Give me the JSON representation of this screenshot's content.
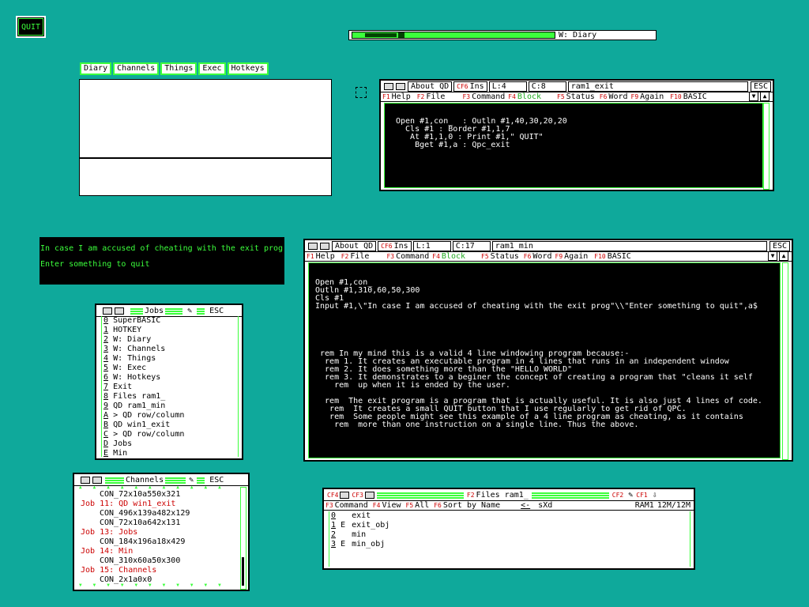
{
  "quit_button": {
    "label": "QUIT"
  },
  "top_bar": {
    "title": "W: Diary"
  },
  "hotkey_menu": {
    "items": [
      "Diary",
      "Channels",
      "Things",
      "Exec",
      "Hotkeys"
    ]
  },
  "console": {
    "lines": [
      "In case I am accused of cheating with the exit prog",
      "Enter something to quit"
    ]
  },
  "editor1": {
    "toolbar": {
      "about": "About QD",
      "cf6": "CF6",
      "ins": "Ins",
      "line": "L:4",
      "col": "C:8",
      "filename": "ram1_exit",
      "esc": "ESC"
    },
    "menu": [
      {
        "key": "F1",
        "label": "Help"
      },
      {
        "key": "F2",
        "label": "File"
      },
      {
        "key": "F3",
        "label": "Command"
      },
      {
        "key": "F4",
        "label": "Block"
      },
      {
        "key": "F5",
        "label": "Status"
      },
      {
        "key": "F6",
        "label": "Word"
      },
      {
        "key": "F9",
        "label": "Again"
      },
      {
        "key": "F10",
        "label": "BASIC"
      }
    ],
    "text": "Open #1,con_  : Outln #1,40,30,20,20\n  Cls #1 : Border #1,1,7\n   At #1,1,0 : Print #1,\" QUIT\"\n    Bget #1,a : Qpc_exit"
  },
  "editor2": {
    "toolbar": {
      "about": "About QD",
      "cf6": "CF6",
      "ins": "Ins",
      "line": "L:1",
      "col": "C:17",
      "filename": "ram1_min",
      "esc": "ESC"
    },
    "menu": [
      {
        "key": "F1",
        "label": "Help"
      },
      {
        "key": "F2",
        "label": "File"
      },
      {
        "key": "F3",
        "label": "Command"
      },
      {
        "key": "F4",
        "label": "Block"
      },
      {
        "key": "F5",
        "label": "Status"
      },
      {
        "key": "F6",
        "label": "Word"
      },
      {
        "key": "F9",
        "label": "Again"
      },
      {
        "key": "F10",
        "label": "BASIC"
      }
    ],
    "text": "Open #1,con_\nOutln #1,310,60,50,300\nCls #1\nInput #1,\\\"In case I am accused of cheating with the exit prog\"\\\\\"Enter something to quit\",a$\n\n\n\n\n\n rem In my mind this is a valid 4 line windowing program because:-\n  rem 1. It creates an executable program in 4 lines that runs in an independent window\n  rem 2. It does something more than the \"HELLO WORLD\"\n  rem 3. It demonstrates to a beginer the concept of creating a program that \"cleans it self\n    rem  up when it is ended by the user.\n\n  rem  The exit program is a program that is actually useful. It is also just 4 lines of code.\n   rem  It creates a small QUIT button that I use regularly to get rid of QPC.\n   rem  Some people might see this example of a 4 line program as cheating, as it contains\n    rem  more than one instruction on a single line. Thus the above."
  },
  "jobs": {
    "title": "Jobs",
    "esc": "ESC",
    "items": [
      {
        "key": "0",
        "label": "SuperBASIC"
      },
      {
        "key": "1",
        "label": "HOTKEY"
      },
      {
        "key": "2",
        "label": "W: Diary"
      },
      {
        "key": "3",
        "label": "W: Channels"
      },
      {
        "key": "4",
        "label": "W: Things"
      },
      {
        "key": "5",
        "label": "W: Exec"
      },
      {
        "key": "6",
        "label": "W: Hotkeys"
      },
      {
        "key": "7",
        "label": "Exit"
      },
      {
        "key": "8",
        "label": "Files ram1_"
      },
      {
        "key": "9",
        "label": "QD ram1_min"
      },
      {
        "key": "A",
        "label": "> QD row/column"
      },
      {
        "key": "B",
        "label": "QD win1_exit"
      },
      {
        "key": "C",
        "label": "> QD row/column"
      },
      {
        "key": "D",
        "label": "Jobs"
      },
      {
        "key": "E",
        "label": "Min"
      }
    ]
  },
  "channels": {
    "title": "Channels",
    "esc": "ESC",
    "rows": [
      {
        "type": "chan",
        "text": "CON_72x10a550x321"
      },
      {
        "type": "job",
        "text": "Job 11: QD win1_exit"
      },
      {
        "type": "chan",
        "text": "CON_496x139a482x129"
      },
      {
        "type": "chan",
        "text": "CON_72x10a642x131"
      },
      {
        "type": "job",
        "text": "Job 13: Jobs"
      },
      {
        "type": "chan",
        "text": "CON_184x196a18x429"
      },
      {
        "type": "job",
        "text": "Job 14: Min"
      },
      {
        "type": "chan",
        "text": "CON_310x60a50x300"
      },
      {
        "type": "job",
        "text": "Job 15: Channels"
      },
      {
        "type": "chan",
        "text": "CON_2x1a0x0"
      }
    ]
  },
  "files": {
    "cf4": "CF4",
    "cf3": "CF3",
    "f2": "F2",
    "title": "Files ram1_",
    "cf2": "CF2",
    "cf1": "CF1",
    "menu": [
      {
        "key": "F3",
        "label": "Command"
      },
      {
        "key": "F4",
        "label": "View"
      },
      {
        "key": "F5",
        "label": "All"
      },
      {
        "key": "F6",
        "label": "Sort by Name"
      }
    ],
    "back": "<-",
    "sxd": "sXd",
    "device": "RAM1",
    "space": "12M/12M",
    "items": [
      {
        "key": "0",
        "flag": "",
        "name": "exit"
      },
      {
        "key": "1",
        "flag": "E",
        "name": "exit_obj"
      },
      {
        "key": "2",
        "flag": "",
        "name": "min"
      },
      {
        "key": "3",
        "flag": "E",
        "name": "min_obj"
      }
    ]
  }
}
